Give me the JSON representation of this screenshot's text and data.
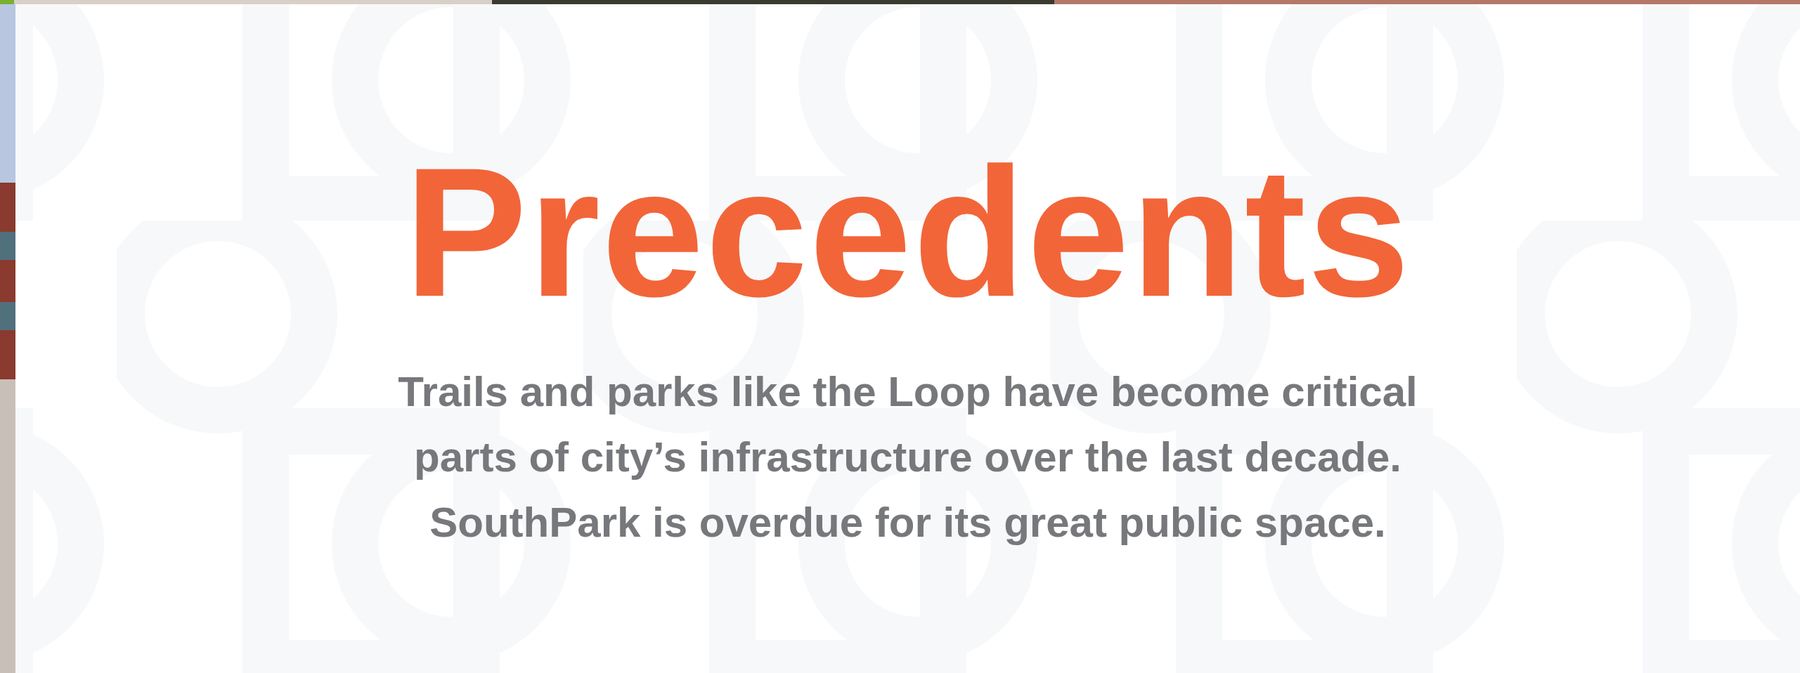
{
  "heading": "Precedents",
  "intro_lines": [
    "Trails and parks like the Loop have become critical",
    "parts of city’s infrastructure over the last decade.",
    "SouthPark is overdue for its great public space."
  ]
}
